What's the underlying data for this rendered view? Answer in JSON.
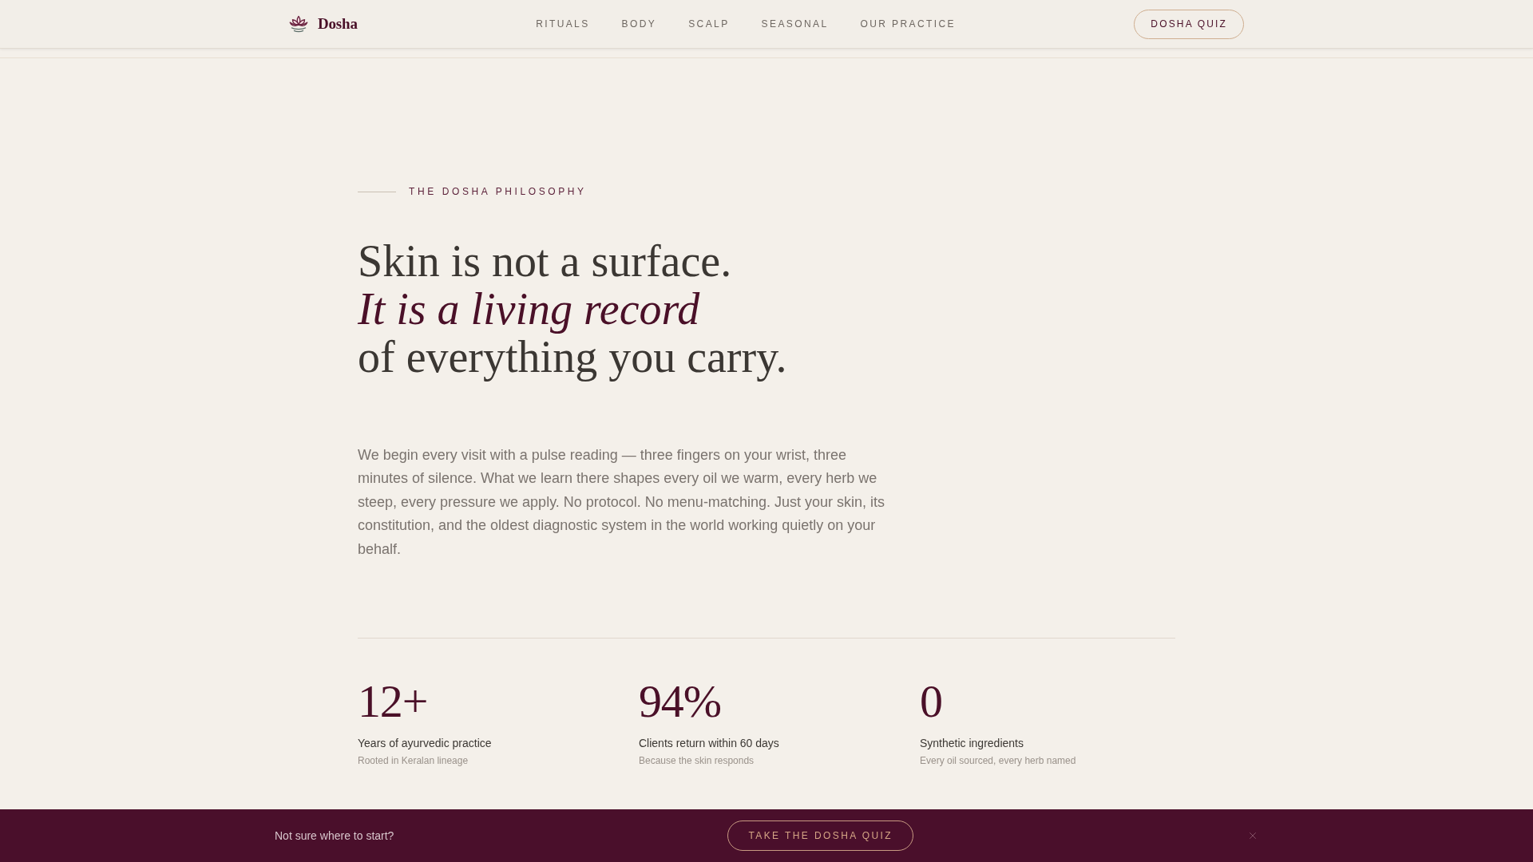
{
  "nav": {
    "brand": "Dosha",
    "links": [
      "RITUALS",
      "BODY",
      "SCALP",
      "SEASONAL",
      "OUR PRACTICE"
    ],
    "cta": "DOSHA QUIZ"
  },
  "hero": {
    "eyebrow": "THE DOSHA PHILOSOPHY",
    "heading": [
      {
        "kind": "plain",
        "text": "Skin is not a surface."
      },
      {
        "kind": "accent",
        "text": "It is a living record"
      },
      {
        "kind": "plain",
        "text": "of everything you carry."
      }
    ],
    "body": "We begin every visit with a pulse reading — three fingers on your wrist, three minutes of silence. What we learn there shapes every oil we warm, every herb we steep, every pressure we apply. No protocol. No menu-matching. Just your skin, its constitution, and the oldest diagnostic system in the world working quietly on your behalf."
  },
  "stats": [
    {
      "value": "12+",
      "label": "Years of ayurvedic practice",
      "note": "Rooted in Keralan lineage"
    },
    {
      "value": "94%",
      "label": "Clients return within 60 days",
      "note": "Because the skin responds"
    },
    {
      "value": "0",
      "label": "Synthetic ingredients",
      "note": "Every oil sourced, every herb named"
    }
  ],
  "banner": {
    "text": "Not sure where to start?",
    "button": "TAKE THE DOSHA QUIZ"
  }
}
